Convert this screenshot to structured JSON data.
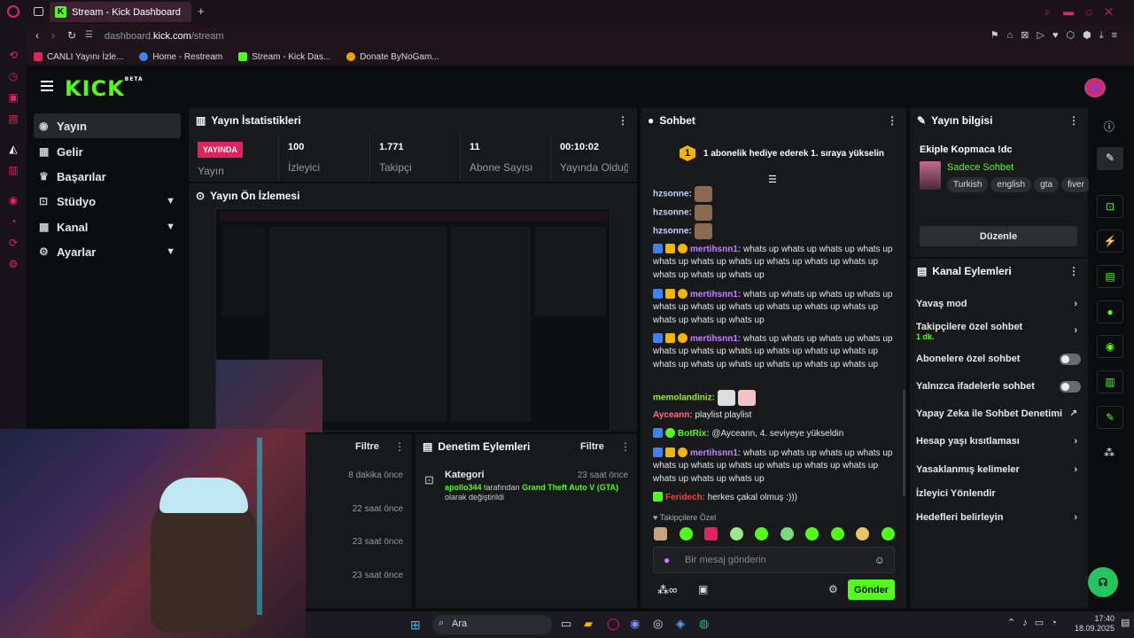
{
  "browser": {
    "tab_title": "Stream - Kick Dashboard",
    "url_prefix": "dashboard.",
    "url_domain": "kick.com",
    "url_path": "/stream",
    "bookmarks": [
      {
        "label": "CANLI Yayını İzle...",
        "color": "#e0245e"
      },
      {
        "label": "Home - Restream",
        "color": "#3b82f6"
      },
      {
        "label": "Stream - Kick Das...",
        "color": "#53fc18"
      },
      {
        "label": "Donate ByNoGam...",
        "color": "#f59e0b"
      }
    ]
  },
  "header": {
    "logo": "KICK",
    "beta": "BETA"
  },
  "sidebar": {
    "items": [
      {
        "label": "Yayın",
        "icon": "broadcast-icon"
      },
      {
        "label": "Gelir",
        "icon": "revenue-icon"
      },
      {
        "label": "Başarılar",
        "icon": "trophy-icon"
      },
      {
        "label": "Stüdyo",
        "icon": "studio-icon"
      },
      {
        "label": "Kanal",
        "icon": "channel-icon"
      },
      {
        "label": "Ayarlar",
        "icon": "gear-icon"
      }
    ]
  },
  "stats": {
    "title": "Yayın İstatistikleri",
    "live_badge": "YAYINDA",
    "live_label": "Yayın",
    "viewers": "100",
    "viewers_label": "İzleyici",
    "followers": "1.771",
    "followers_label": "Takipçi",
    "subs": "11",
    "subs_label": "Abone Sayısı",
    "uptime": "00:10:02",
    "uptime_label": "Yayında Olduğu Süre"
  },
  "preview": {
    "title": "Yayın Ön İzlemesi"
  },
  "activity": {
    "filter": "Filtre",
    "times": [
      "8 dakika önce",
      "22 saat önce",
      "23 saat önce",
      "23 saat önce"
    ]
  },
  "moderation": {
    "title": "Denetim Eylemleri",
    "filter": "Filtre",
    "entry_title": "Kategori",
    "entry_time": "23 saat önce",
    "entry_user": "apollo344",
    "entry_mid": " tarafından ",
    "entry_game": "Grand Theft Auto V (GTA)",
    "entry_end": "olarak değiştirildi"
  },
  "chat": {
    "title": "Sohbet",
    "goal_num": "1",
    "goal_text": "1 abonelik hediye ederek 1. sıraya yükselin",
    "messages": [
      {
        "user": "hzsonne:",
        "text": "",
        "color": "#c8d0ff"
      },
      {
        "user": "hzsonne:",
        "text": "",
        "color": "#c8d0ff"
      },
      {
        "user": "hzsonne:",
        "text": "",
        "color": "#c8d0ff"
      },
      {
        "user": "mertihsnn1:",
        "text": "whats up whats up whats up whats up whats up whats up whats up whats up whats up whats up whats up whats up whats up",
        "color": "#c084fc"
      },
      {
        "user": "mertihsnn1:",
        "text": "whats up whats up whats up whats up whats up whats up whats up whats up whats up whats up whats up whats up whats up",
        "color": "#c084fc"
      },
      {
        "user": "mertihsnn1:",
        "text": "whats up whats up whats up whats up whats up whats up whats up whats up whats up whats up whats up whats up whats up whats up whats up whats up",
        "color": "#c084fc"
      },
      {
        "user": "memolandiniz:",
        "text": "",
        "color": "#a3e635"
      },
      {
        "user": "Ayceann:",
        "text": "playlist playlist",
        "color": "#fb7185"
      },
      {
        "user": "BotRix:",
        "text": "@Ayceann, 4. seviyeye yükseldin",
        "color": "#53fc18"
      },
      {
        "user": "mertihsnn1:",
        "text": "whats up whats up whats up whats up whats up whats up whats up whats up whats up whats up whats up whats up whats up",
        "color": "#c084fc"
      },
      {
        "user": "Feridech:",
        "text": "herkes çakal olmuş :)))",
        "color": "#ef4444"
      }
    ],
    "emote_section": "Takipçilere Özel",
    "placeholder": "Bir mesaj gönderin",
    "send": "Gönder"
  },
  "stream_info": {
    "title": "Yayın bilgisi",
    "stream_title": "Ekiple Kopmaca !dc",
    "category": "Sadece Sohbet",
    "tags": [
      "Turkish",
      "english",
      "gta",
      "fiver"
    ],
    "edit": "Düzenle"
  },
  "channel_actions": {
    "title": "Kanal Eylemleri",
    "items": [
      {
        "label": "Yavaş mod",
        "sub": "",
        "control": "arrow"
      },
      {
        "label": "Takipçilere özel sohbet",
        "sub": "1 dk.",
        "control": "arrow"
      },
      {
        "label": "Abonelere özel sohbet",
        "sub": "",
        "control": "toggle"
      },
      {
        "label": "Yalnızca ifadelerle sohbet",
        "sub": "",
        "control": "toggle"
      },
      {
        "label": "Yapay Zeka ile Sohbet Denetimi",
        "sub": "",
        "control": "external"
      },
      {
        "label": "Hesap yaşı kısıtlaması",
        "sub": "",
        "control": "arrow"
      },
      {
        "label": "Yasaklanmış kelimeler",
        "sub": "",
        "control": "arrow"
      },
      {
        "label": "İzleyici Yönlendir",
        "sub": "",
        "control": "none"
      },
      {
        "label": "Hedefleri belirleyin",
        "sub": "",
        "control": "arrow"
      }
    ]
  },
  "taskbar": {
    "search": "Ara",
    "time": "17:40",
    "date": "18.09.2025"
  },
  "colors": {
    "accent": "#53fc18",
    "live": "#e0245e",
    "panel": "#18191b"
  }
}
